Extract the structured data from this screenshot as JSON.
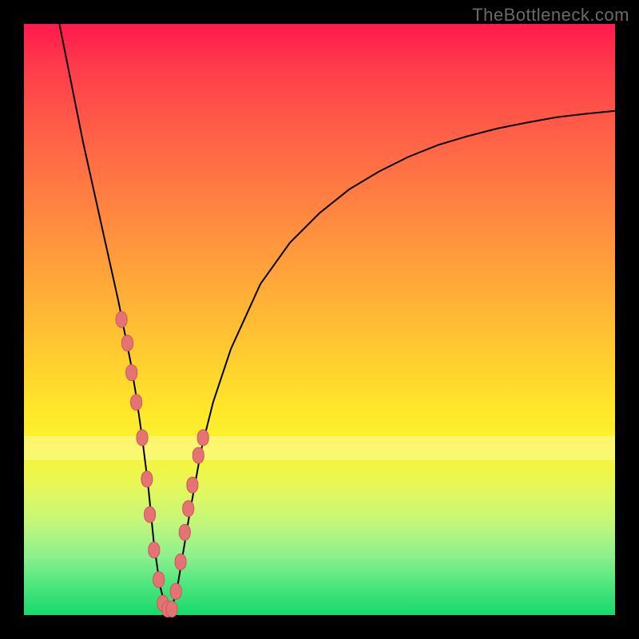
{
  "watermark": "TheBottleneck.com",
  "chart_data": {
    "type": "line",
    "title": "",
    "xlabel": "",
    "ylabel": "",
    "ylim": [
      0,
      100
    ],
    "xlim": [
      0,
      100
    ],
    "series": [
      {
        "name": "bottleneck-curve",
        "x": [
          6,
          8,
          10,
          12,
          14,
          16,
          18,
          19,
          20,
          21,
          22,
          23,
          24,
          25,
          26,
          28,
          30,
          32,
          35,
          40,
          45,
          50,
          55,
          60,
          65,
          70,
          75,
          80,
          85,
          90,
          95,
          100
        ],
        "y": [
          100,
          90,
          80,
          71,
          62,
          53,
          43,
          37,
          30,
          22,
          12,
          5,
          1,
          1,
          5,
          17,
          28,
          36,
          45,
          56,
          63,
          68,
          72,
          75,
          77.5,
          79.5,
          81,
          82.3,
          83.3,
          84.2,
          84.8,
          85.3
        ]
      }
    ],
    "markers": {
      "name": "sample-points",
      "x": [
        16.5,
        17.5,
        18.2,
        19.0,
        20.0,
        20.8,
        21.3,
        22.0,
        22.8,
        23.5,
        24.3,
        25.0,
        25.7,
        26.5,
        27.2,
        27.8,
        28.5,
        29.5,
        30.3
      ],
      "y": [
        50,
        46,
        41,
        36,
        30,
        23,
        17,
        11,
        6,
        2,
        1,
        1,
        4,
        9,
        14,
        18,
        22,
        27,
        30
      ]
    },
    "background_gradient": {
      "top": "#ff1a4d",
      "upper_mid": "#ff8f3f",
      "mid": "#ffe92a",
      "lower_mid": "#c6f779",
      "bottom": "#17d96b"
    }
  }
}
